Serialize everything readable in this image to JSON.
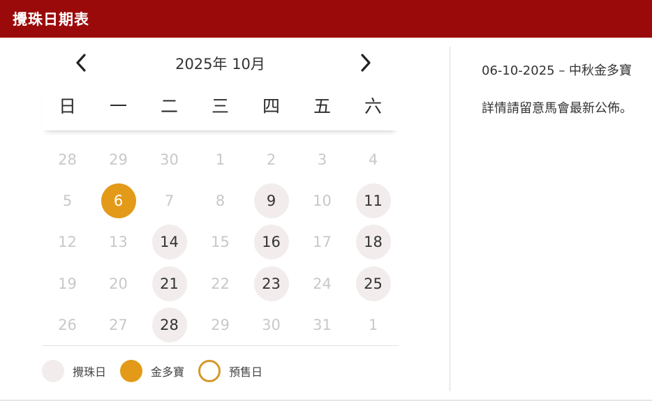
{
  "header": {
    "title": "攪珠日期表"
  },
  "calendar": {
    "month_label": "2025年 10月",
    "weekdays": [
      "日",
      "一",
      "二",
      "三",
      "四",
      "五",
      "六"
    ],
    "weeks": [
      [
        {
          "d": "28",
          "t": "out"
        },
        {
          "d": "29",
          "t": "out"
        },
        {
          "d": "30",
          "t": "out"
        },
        {
          "d": "1",
          "t": "none"
        },
        {
          "d": "2",
          "t": "none"
        },
        {
          "d": "3",
          "t": "none"
        },
        {
          "d": "4",
          "t": "none"
        }
      ],
      [
        {
          "d": "5",
          "t": "none"
        },
        {
          "d": "6",
          "t": "jackpot"
        },
        {
          "d": "7",
          "t": "none"
        },
        {
          "d": "8",
          "t": "none"
        },
        {
          "d": "9",
          "t": "draw"
        },
        {
          "d": "10",
          "t": "none"
        },
        {
          "d": "11",
          "t": "draw"
        }
      ],
      [
        {
          "d": "12",
          "t": "none"
        },
        {
          "d": "13",
          "t": "none"
        },
        {
          "d": "14",
          "t": "draw"
        },
        {
          "d": "15",
          "t": "none"
        },
        {
          "d": "16",
          "t": "draw"
        },
        {
          "d": "17",
          "t": "none"
        },
        {
          "d": "18",
          "t": "draw"
        }
      ],
      [
        {
          "d": "19",
          "t": "none"
        },
        {
          "d": "20",
          "t": "none"
        },
        {
          "d": "21",
          "t": "draw"
        },
        {
          "d": "22",
          "t": "none"
        },
        {
          "d": "23",
          "t": "draw"
        },
        {
          "d": "24",
          "t": "none"
        },
        {
          "d": "25",
          "t": "draw"
        }
      ],
      [
        {
          "d": "26",
          "t": "none"
        },
        {
          "d": "27",
          "t": "none"
        },
        {
          "d": "28",
          "t": "draw"
        },
        {
          "d": "29",
          "t": "none"
        },
        {
          "d": "30",
          "t": "none"
        },
        {
          "d": "31",
          "t": "none"
        },
        {
          "d": "1",
          "t": "out"
        }
      ]
    ]
  },
  "legend": {
    "draw_label": "攪珠日",
    "jackpot_label": "金多寶",
    "presale_label": "預售日"
  },
  "info": {
    "line1": "06-10-2025 – 中秋金多寶",
    "line2": "詳情請留意馬會最新公佈。"
  },
  "icons": {
    "prev": "chevron-left-icon",
    "next": "chevron-right-icon"
  },
  "colors": {
    "header": "#9b0a0a",
    "draw": "#f2eced",
    "jackpot": "#e39a18",
    "presale": "#d4982a"
  }
}
